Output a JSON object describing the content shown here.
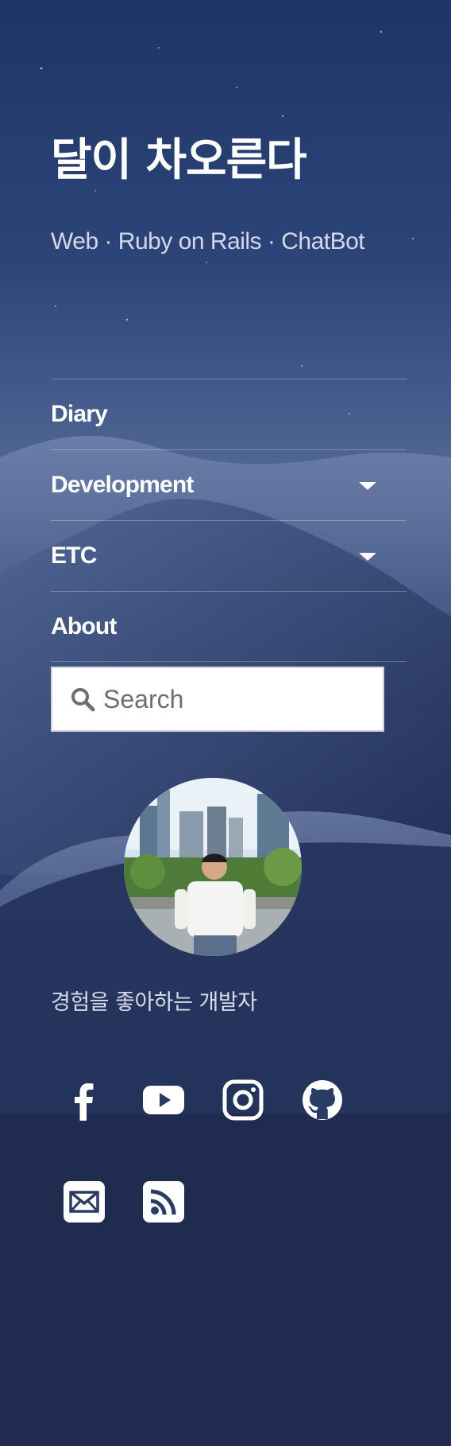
{
  "site": {
    "title": "달이 차오른다",
    "tagline": "Web · Ruby on Rails · ChatBot"
  },
  "nav": {
    "items": [
      {
        "label": "Diary",
        "has_dropdown": false
      },
      {
        "label": "Development",
        "has_dropdown": true
      },
      {
        "label": "ETC",
        "has_dropdown": true
      },
      {
        "label": "About",
        "has_dropdown": false
      }
    ]
  },
  "search": {
    "placeholder": "Search",
    "icon": "search-icon"
  },
  "profile": {
    "avatar": "profile-photo",
    "bio": "경험을 좋아하는 개발자"
  },
  "social": {
    "links": [
      {
        "name": "facebook",
        "icon": "facebook-icon"
      },
      {
        "name": "youtube",
        "icon": "youtube-icon"
      },
      {
        "name": "instagram",
        "icon": "instagram-icon"
      },
      {
        "name": "github",
        "icon": "github-icon"
      },
      {
        "name": "email",
        "icon": "envelope-icon"
      },
      {
        "name": "rss",
        "icon": "rss-icon"
      }
    ]
  },
  "colors": {
    "background": "#24355f",
    "text": "#ffffff",
    "muted_text": "#d3d9e8",
    "search_bg": "#ffffff"
  }
}
